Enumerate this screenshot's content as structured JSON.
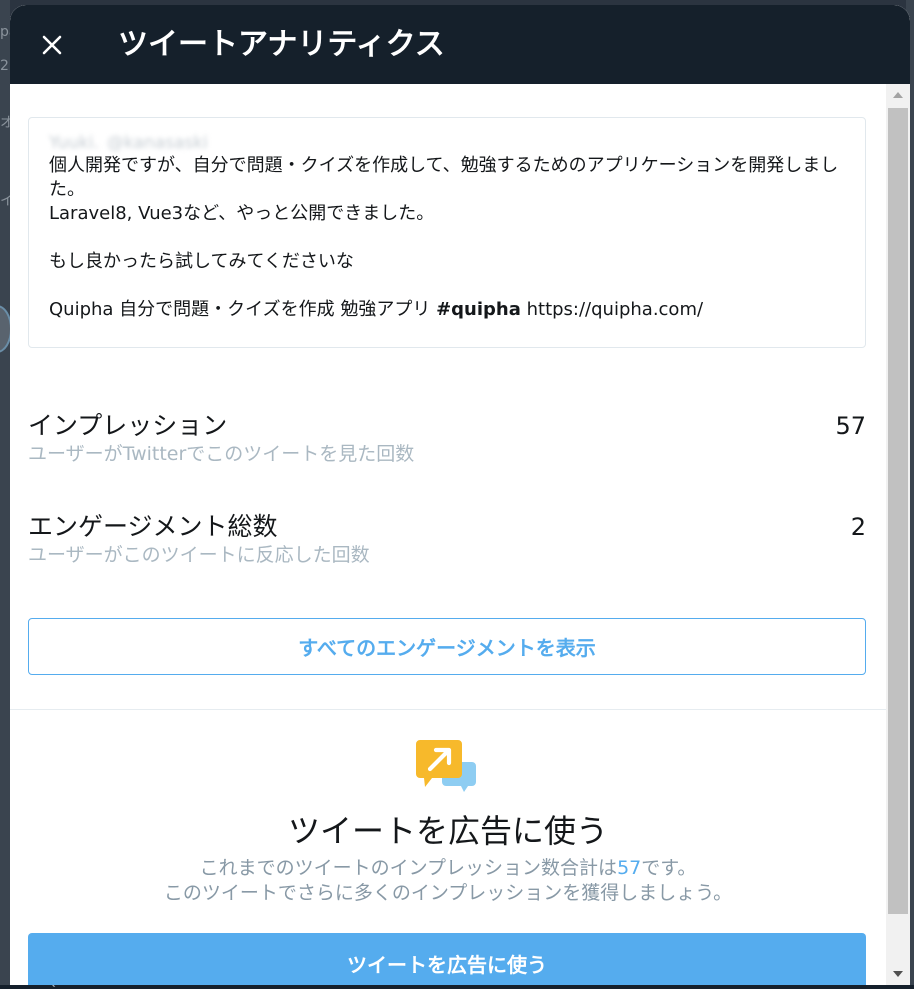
{
  "background": {
    "left_fragments": [
      "pa",
      "2",
      "オ",
      "イ"
    ],
    "bottom_fragment": "Q I"
  },
  "modal": {
    "title": "ツイートアナリティクス",
    "close_icon": "close-icon"
  },
  "tweet": {
    "author_name": "Yuuki.",
    "author_handle": "@kanasaski",
    "lines": [
      "個人開発ですが、自分で問題・クイズを作成して、勉強するためのアプリケーションを開発しました。",
      "Laravel8, Vue3など、やっと公開できました。",
      "もし良かったら試してみてくださいな"
    ],
    "last_line_prefix": "Quipha 自分で問題・クイズを作成 勉強アプリ ",
    "last_line_hashtag": "#quipha",
    "last_line_url": " https://quipha.com/"
  },
  "stats": [
    {
      "title": "インプレッション",
      "description": "ユーザーがTwitterでこのツイートを見た回数",
      "value": "57"
    },
    {
      "title": "エンゲージメント総数",
      "description": "ユーザーがこのツイートに反応した回数",
      "value": "2"
    }
  ],
  "engagements_button": "すべてのエンゲージメントを表示",
  "promo": {
    "icon": "promote-tweet-icon",
    "title": "ツイートを広告に使う",
    "desc_prefix": "これまでのツイートのインプレッション数合計は",
    "desc_count": "57",
    "desc_suffix": "です。",
    "desc_line2": "このツイートでさらに多くのインプレッションを獲得しましょう。",
    "button": "ツイートを広告に使う"
  },
  "colors": {
    "header_bg": "#15202b",
    "accent": "#55acee",
    "text_primary": "#14171a",
    "text_secondary": "#aab8c2",
    "promo_icon_yellow": "#f7b92b"
  }
}
